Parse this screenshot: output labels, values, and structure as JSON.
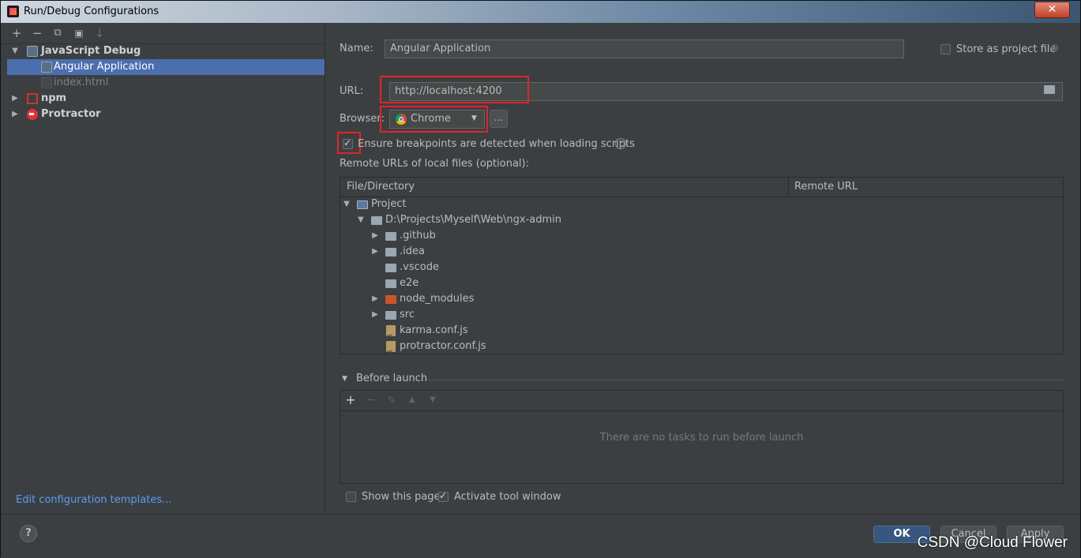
{
  "window": {
    "title": "Run/Debug Configurations",
    "close_label": "✕"
  },
  "toolbar": {
    "add": "+",
    "remove": "−",
    "copy": "⧉",
    "folder": "▣",
    "sort": "↓"
  },
  "tree": {
    "group_js": "JavaScript Debug",
    "item_angular": "Angular Application",
    "item_index": "index.html",
    "group_npm": "npm",
    "group_protractor": "Protractor"
  },
  "edit_templates": "Edit configuration templates...",
  "form": {
    "name_label": "Name:",
    "name_value": "Angular Application",
    "store_label": "Store as project file",
    "url_label": "URL:",
    "url_value": "http://localhost:4200",
    "browser_label": "Browser:",
    "browser_value": "Chrome",
    "browser_more": "...",
    "ensure_label": "Ensure breakpoints are detected when loading scripts",
    "remote_label": "Remote URLs of local files (optional):"
  },
  "table": {
    "col1": "File/Directory",
    "col2": "Remote URL",
    "rows": [
      "Project",
      "D:\\Projects\\Myself\\Web\\ngx-admin",
      ".github",
      ".idea",
      ".vscode",
      "e2e",
      "node_modules",
      "src",
      "karma.conf.js",
      "protractor.conf.js"
    ]
  },
  "before_launch": {
    "title": "Before launch",
    "empty": "There are no tasks to run before launch",
    "add": "+",
    "remove": "−",
    "edit": "✎",
    "up": "▲",
    "down": "▼"
  },
  "options": {
    "show_page": "Show this page",
    "activate_tool": "Activate tool window"
  },
  "buttons": {
    "help": "?",
    "ok": "OK",
    "cancel": "Cancel",
    "apply": "Apply"
  },
  "watermark": "CSDN @Cloud Flower",
  "colors": {
    "selection": "#4b6eaf",
    "accent_link": "#589df6",
    "highlight_box": "#e0242a",
    "primary_button": "#365880"
  }
}
